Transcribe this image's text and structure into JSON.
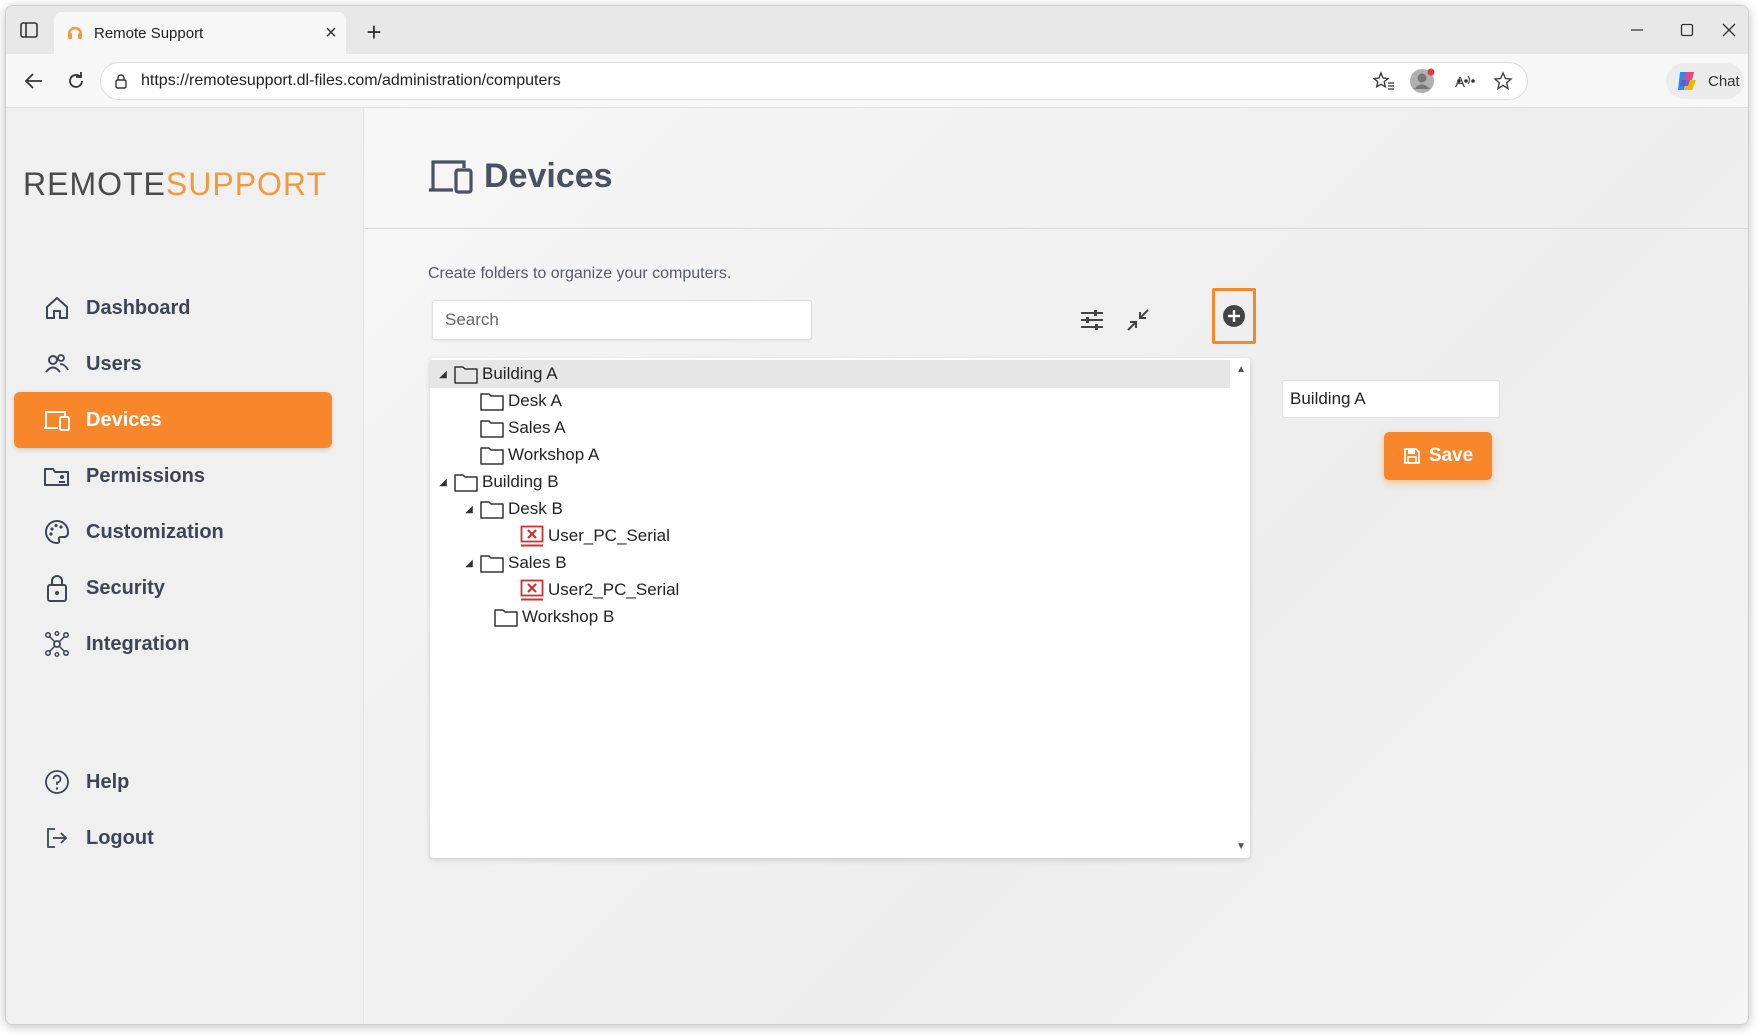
{
  "browser": {
    "tab_title": "Remote Support",
    "url": "https://remotesupport.dl-files.com/administration/computers",
    "chat_label": "Chat"
  },
  "logo": {
    "part1": "REMOTE",
    "part2": "SUPPORT"
  },
  "sidebar": {
    "items": [
      {
        "label": "Dashboard",
        "icon": "home-icon"
      },
      {
        "label": "Users",
        "icon": "users-icon"
      },
      {
        "label": "Devices",
        "icon": "devices-icon",
        "active": true
      },
      {
        "label": "Permissions",
        "icon": "permissions-icon"
      },
      {
        "label": "Customization",
        "icon": "palette-icon"
      },
      {
        "label": "Security",
        "icon": "lock-icon"
      },
      {
        "label": "Integration",
        "icon": "integration-icon"
      }
    ],
    "bottom_items": [
      {
        "label": "Help",
        "icon": "help-icon"
      },
      {
        "label": "Logout",
        "icon": "logout-icon"
      }
    ]
  },
  "main": {
    "title": "Devices",
    "subtitle": "Create folders to organize your computers.",
    "search_placeholder": "Search",
    "tree": [
      {
        "label": "Building A",
        "level": 0,
        "type": "folder",
        "expanded": true,
        "selected": true
      },
      {
        "label": "Desk A",
        "level": 1,
        "type": "folder"
      },
      {
        "label": "Sales A",
        "level": 1,
        "type": "folder"
      },
      {
        "label": "Workshop A",
        "level": 1,
        "type": "folder"
      },
      {
        "label": "Building B",
        "level": 0,
        "type": "folder",
        "expanded": true
      },
      {
        "label": "Desk B",
        "level": 1,
        "type": "folder",
        "expanded": true
      },
      {
        "label": "User_PC_Serial",
        "level": 2,
        "type": "computer-offline"
      },
      {
        "label": "Sales B",
        "level": 1,
        "type": "folder",
        "expanded": true
      },
      {
        "label": "User2_PC_Serial",
        "level": 2,
        "type": "computer-offline"
      },
      {
        "label": "Workshop B",
        "level": 1,
        "type": "folder"
      }
    ],
    "name_field_value": "Building A",
    "save_label": "Save"
  },
  "colors": {
    "accent": "#f7872a",
    "logo_dark": "#4a4a4a",
    "logo_orange": "#f39a3c",
    "offline_red": "#d0302f"
  }
}
